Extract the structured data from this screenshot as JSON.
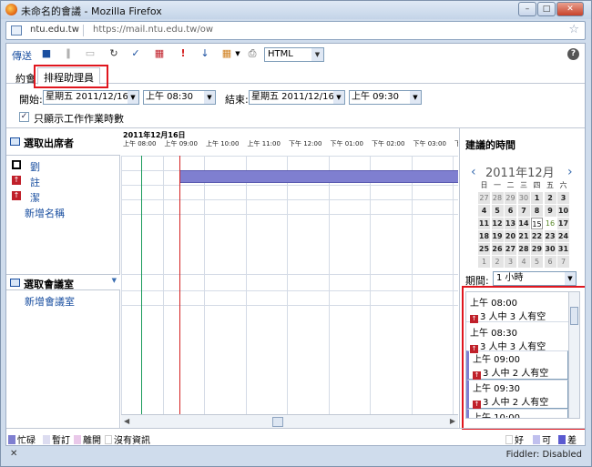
{
  "window": {
    "title": "未命名的會議 - Mozilla Firefox"
  },
  "urlbar": {
    "domain": "ntu.edu.tw",
    "url": "https://mail.ntu.edu.tw/ow"
  },
  "toolbar": {
    "send_label": "傳送",
    "format_value": "HTML"
  },
  "tabs": {
    "appointment": "約會",
    "scheduling_assistant": "排程助理員"
  },
  "dates": {
    "start_label": "開始:",
    "start_date": "星期五 2011/12/16",
    "start_time": "上午 08:30",
    "end_label": "結束:",
    "end_date": "星期五 2011/12/16",
    "end_time": "上午 09:30"
  },
  "working_hours_label": "只顯示工作作業時數",
  "attendees": {
    "header": "選取出席者",
    "items": [
      {
        "name": "劉",
        "icon_color": "#000000"
      },
      {
        "name": "註",
        "icon_color": "#c0202a"
      },
      {
        "name": "潔",
        "icon_color": "#c0202a"
      }
    ],
    "add_label": "新增名稱"
  },
  "rooms": {
    "header": "選取會議室",
    "add_label": "新增會議室"
  },
  "timeline": {
    "date": "2011年12月16日",
    "times": [
      "上午 08:00",
      "上午 09:00",
      "上午 10:00",
      "上午 11:00",
      "下午 12:00",
      "下午 01:00",
      "下午 02:00",
      "下午 03:00",
      "下午 04"
    ]
  },
  "suggestions": {
    "header": "建議的時間",
    "month": "2011年12月",
    "weekdays": [
      "日",
      "一",
      "二",
      "三",
      "四",
      "五",
      "六"
    ],
    "weeks": [
      [
        "27",
        "28",
        "29",
        "30",
        "1",
        "2",
        "3"
      ],
      [
        "4",
        "5",
        "6",
        "7",
        "8",
        "9",
        "10"
      ],
      [
        "11",
        "12",
        "13",
        "14",
        "15",
        "16",
        "17"
      ],
      [
        "18",
        "19",
        "20",
        "21",
        "22",
        "23",
        "24"
      ],
      [
        "25",
        "26",
        "27",
        "28",
        "29",
        "30",
        "31"
      ],
      [
        "1",
        "2",
        "3",
        "4",
        "5",
        "6",
        "7"
      ]
    ],
    "period_label": "期間:",
    "period_value": "1 小時",
    "items": [
      {
        "time": "上午 08:00",
        "availability": "3 人中 3 人有空"
      },
      {
        "time": "上午 08:30",
        "availability": "3 人中 3 人有空"
      },
      {
        "time": "上午 09:00",
        "availability": "3 人中 2 人有空"
      },
      {
        "time": "上午 09:30",
        "availability": "3 人中 2 人有空"
      },
      {
        "time": "上午 10:00",
        "availability": ""
      }
    ]
  },
  "legend": {
    "busy": "忙碌",
    "tentative": "暫訂",
    "away": "離開",
    "no_info": "沒有資訊",
    "good": "好",
    "fair": "可",
    "poor": "差"
  },
  "status": {
    "fiddler": "Fiddler: Disabled"
  },
  "colors": {
    "busy": "#7f7fd0",
    "highlight": "#e0161e",
    "start_line": "#1a9a5a",
    "end_line": "#d42020"
  }
}
